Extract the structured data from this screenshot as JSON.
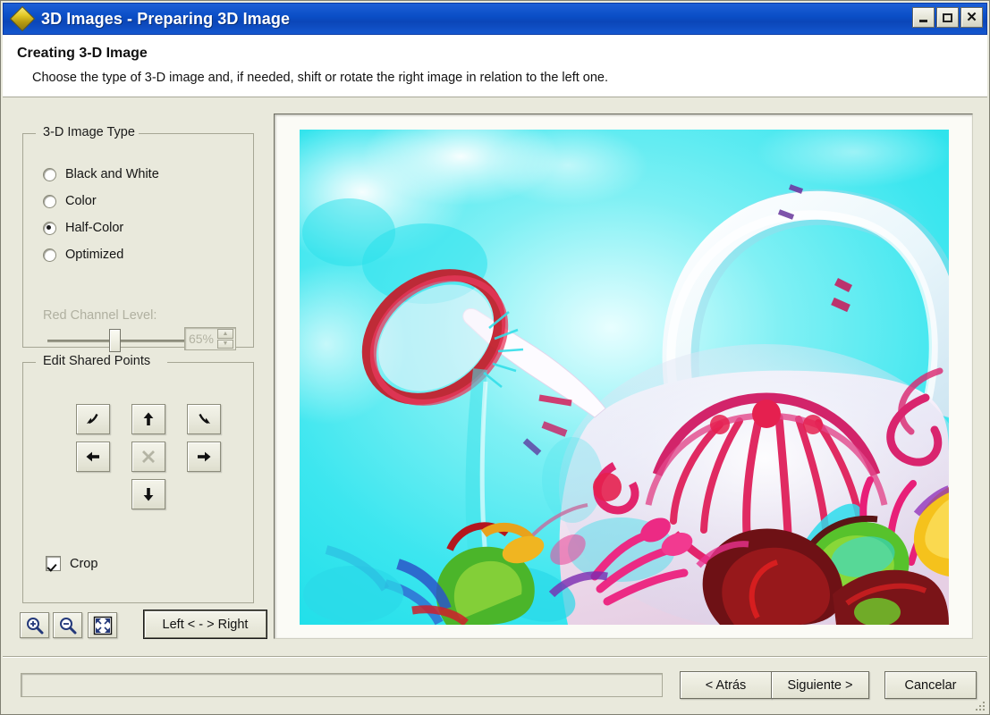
{
  "window": {
    "title": "3D Images - Preparing 3D Image",
    "icon": "diamond-icon",
    "minimize_label": "",
    "maximize_label": "",
    "close_label": "✕"
  },
  "header": {
    "title": "Creating 3-D Image",
    "subtitle": "Choose the type of 3-D image and, if needed, shift or rotate the right image in relation to the left one."
  },
  "image_type": {
    "group_label": "3-D Image Type",
    "options": [
      {
        "label": "Black and White",
        "selected": false
      },
      {
        "label": "Color",
        "selected": false
      },
      {
        "label": "Half-Color",
        "selected": true
      },
      {
        "label": "Optimized",
        "selected": false
      }
    ],
    "red_channel": {
      "label": "Red Channel Level:",
      "value": "65%",
      "slider_percent": 42,
      "enabled": false,
      "spin_up": "▲",
      "spin_down": "▼"
    }
  },
  "shared_points": {
    "group_label": "Edit Shared Points",
    "buttons": [
      {
        "name": "rotate-left",
        "title": "Rotate left"
      },
      {
        "name": "move-up",
        "title": "Move up"
      },
      {
        "name": "rotate-right",
        "title": "Rotate right"
      },
      {
        "name": "move-left",
        "title": "Move left"
      },
      {
        "name": "reset",
        "title": "Reset",
        "disabled": true
      },
      {
        "name": "move-right",
        "title": "Move right"
      },
      {
        "name": "move-down",
        "title": "Move down"
      }
    ]
  },
  "crop": {
    "label": "Crop",
    "checked": true
  },
  "toolbar": {
    "zoom_in": "zoom-in-icon",
    "zoom_out": "zoom-out-icon",
    "fit": "fit-to-window-icon",
    "swap_label": "Left < - > Right"
  },
  "preview": {
    "description": "Red-cyan anaglyph photograph of a white porcelain teapot with pink floral painting and colorful flowers in front of a cyan sky"
  },
  "footer": {
    "progress_value": "",
    "back_label": "< Atrás",
    "next_label": "Siguiente >",
    "cancel_label": "Cancelar"
  },
  "colors": {
    "titlebar_blue": "#0b4ec6",
    "body_beige": "#e9e9dc",
    "accent_cyan": "#2de0ec",
    "accent_magenta": "#e0246f"
  }
}
